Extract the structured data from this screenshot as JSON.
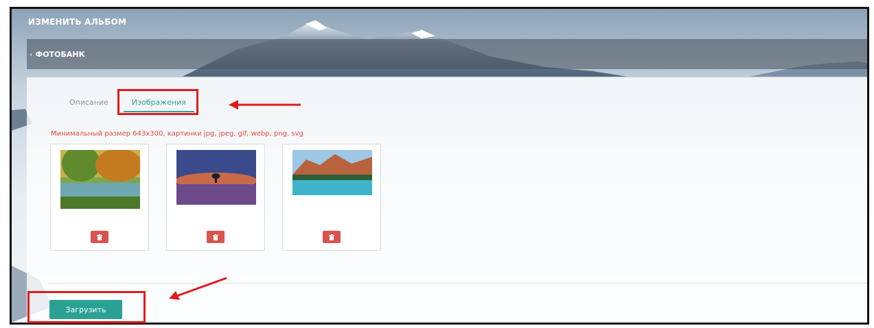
{
  "header": {
    "title": "ИЗМЕНИТЬ АЛЬБОМ"
  },
  "nav": {
    "back_label": "ФОТОБАНК",
    "back_icon": "chevron-left-icon"
  },
  "tabs": [
    {
      "label": "Описание",
      "active": false
    },
    {
      "label": "Изображения",
      "active": true
    }
  ],
  "upload_hint": "Минимальный размер 643x300, картинки jpg, jpeg, gif, webp, png, svg",
  "images": [
    {
      "subject": "autumn lake forest painting",
      "delete_icon": "trash-icon"
    },
    {
      "subject": "lavender field under starry sky",
      "delete_icon": "trash-icon"
    },
    {
      "subject": "mountain lake with turquoise water",
      "delete_icon": "trash-icon"
    }
  ],
  "upload_button": {
    "label": "Загрузить"
  },
  "colors": {
    "accent": "#2ba193",
    "danger": "#d9534f",
    "hint": "#e44848",
    "annotation": "#e01b1b"
  }
}
